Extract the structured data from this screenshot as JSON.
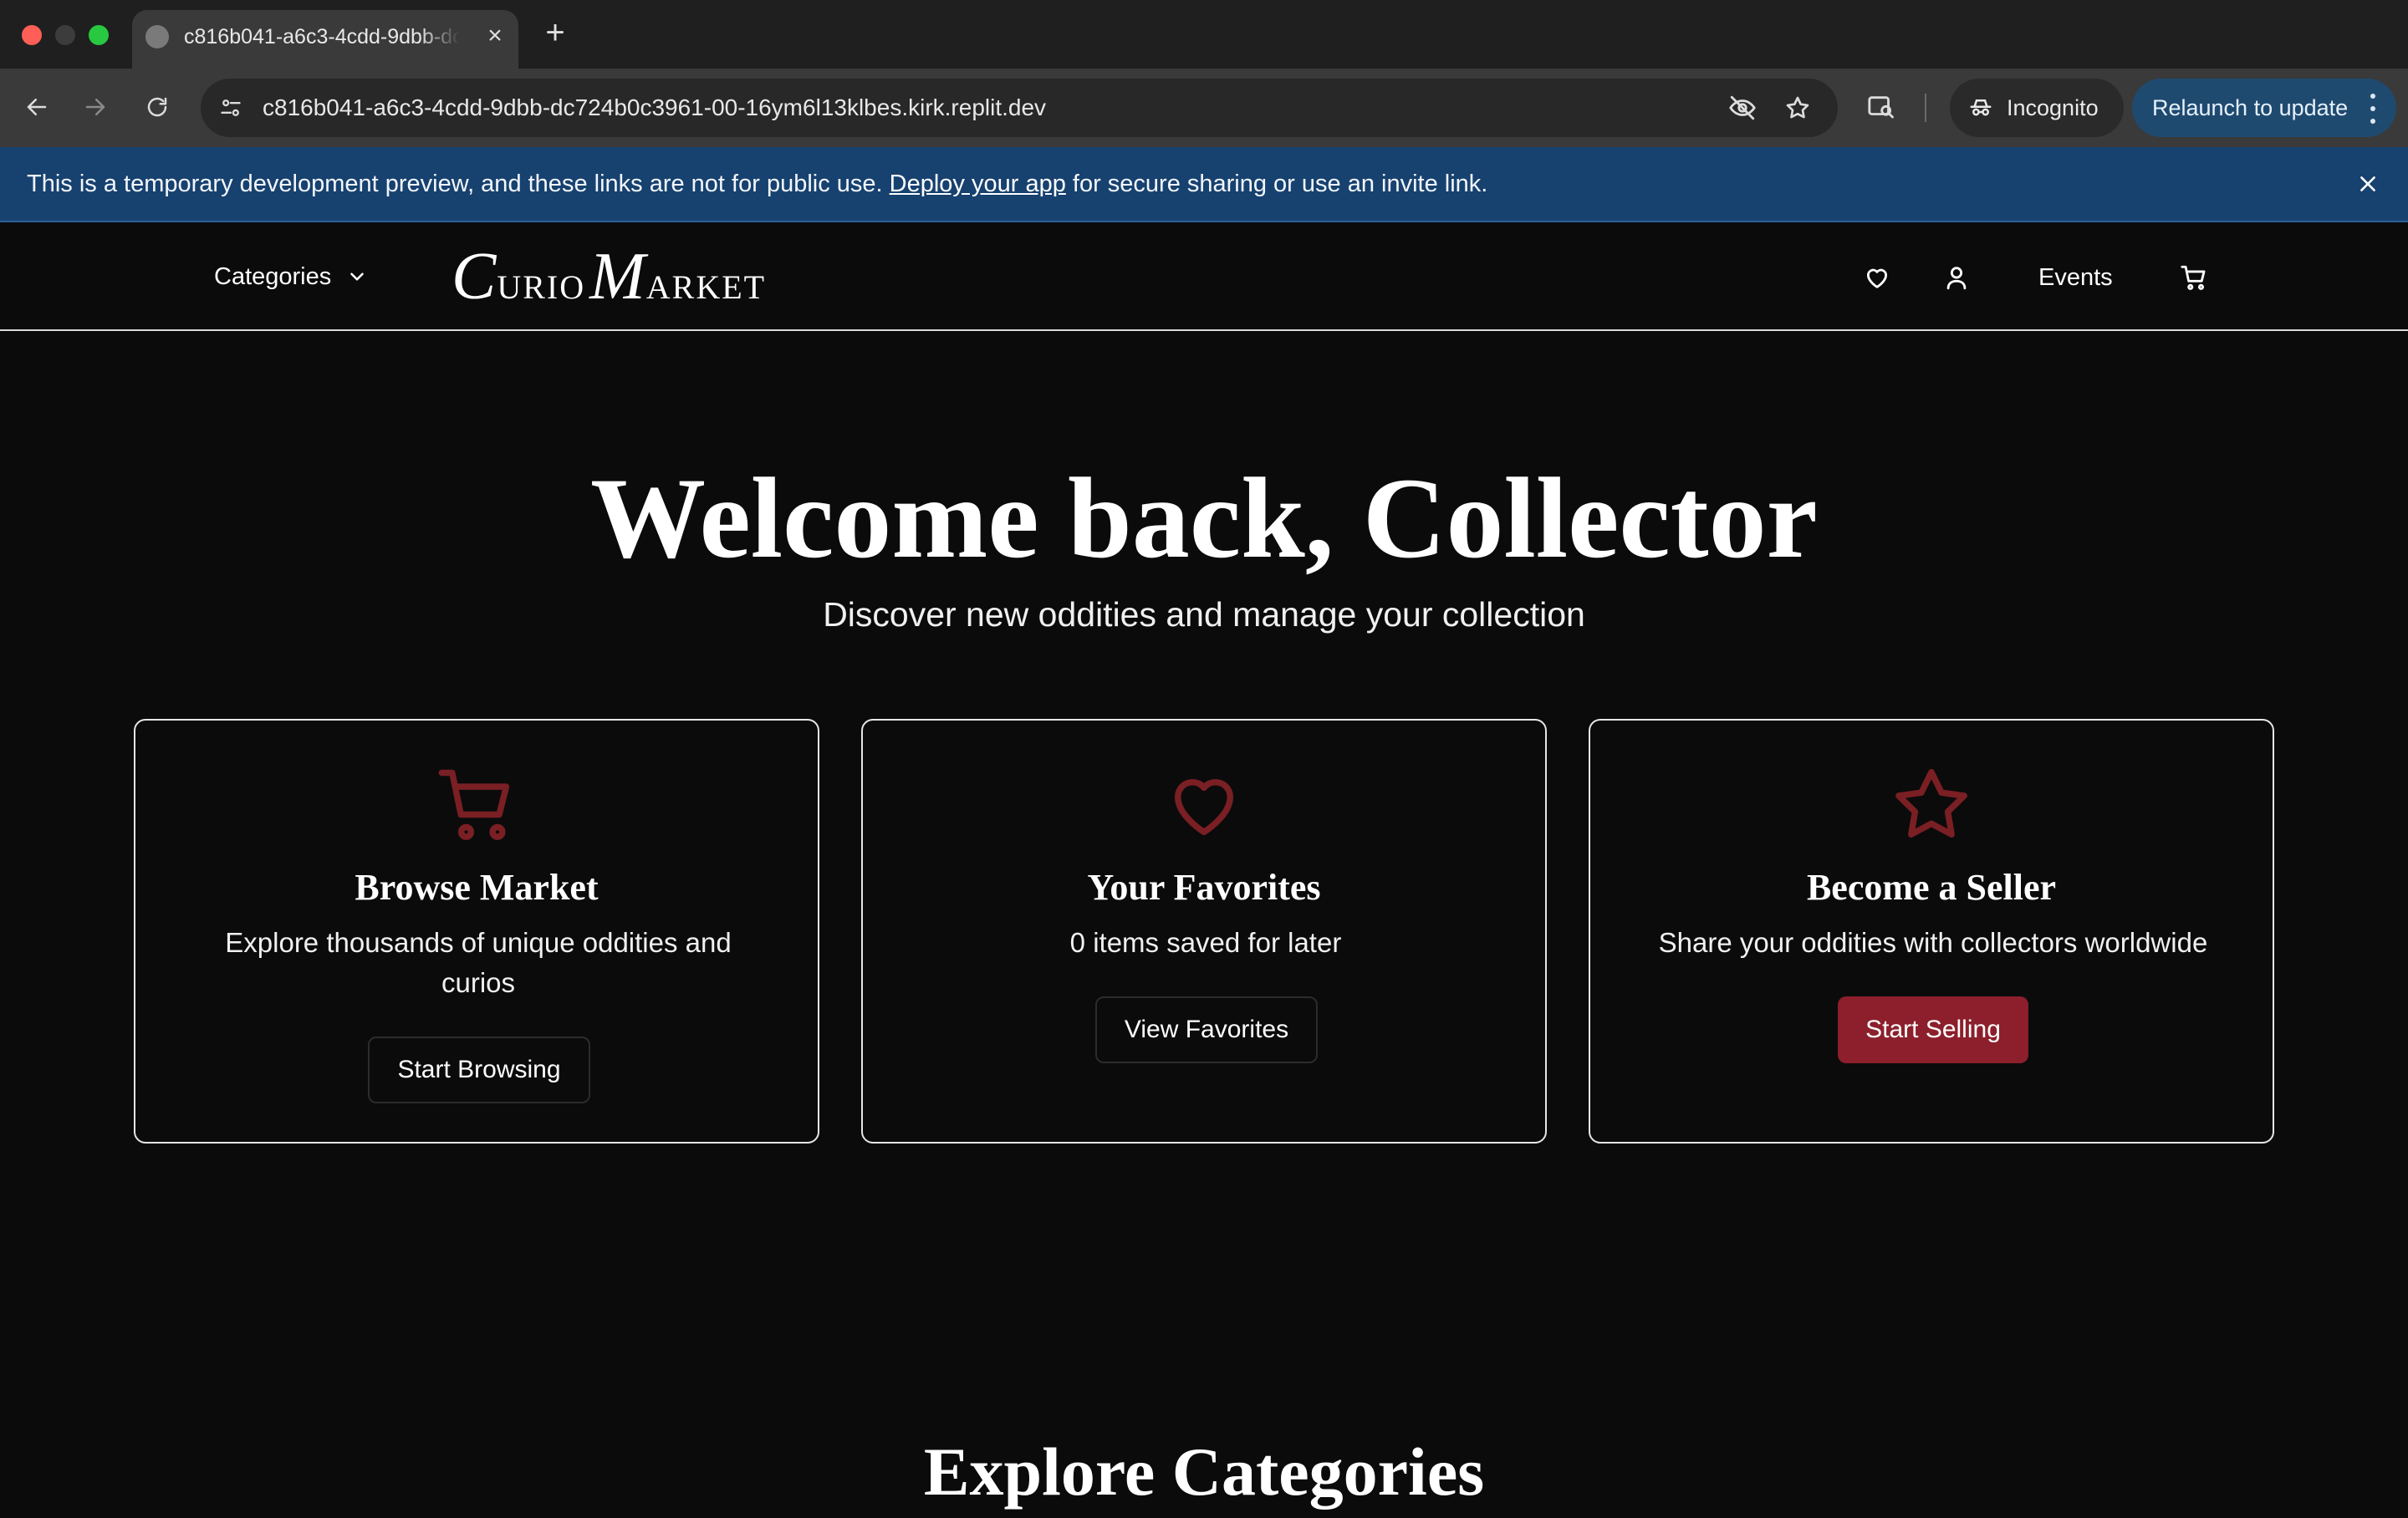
{
  "browser": {
    "tab_title": "c816b041-a6c3-4cdd-9dbb-dc724b0c3961-00-16ym6l13klbes.kirk.replit.dev",
    "url": "c816b041-a6c3-4cdd-9dbb-dc724b0c3961-00-16ym6l13klbes.kirk.replit.dev",
    "incognito_label": "Incognito",
    "relaunch_label": "Relaunch to update",
    "colors": {
      "tabbar": "#1f1f1f",
      "toolbar": "#3a3a3a",
      "relaunch": "#1f4a70"
    }
  },
  "banner": {
    "text_before": "This is a temporary development preview, and these links are not for public use. ",
    "link_text": "Deploy your app",
    "text_after": " for secure sharing or use an invite link.",
    "color": "#17416f"
  },
  "header": {
    "categories_label": "Categories",
    "logo": {
      "c": "C",
      "urio": "URIO",
      "m": "M",
      "arket": "ARKET"
    },
    "events_label": "Events",
    "icons": [
      "heart-icon",
      "user-icon",
      "cart-icon"
    ]
  },
  "hero": {
    "title": "Welcome back, Collector",
    "subtitle": "Discover new oddities and manage your collection"
  },
  "cards": [
    {
      "icon": "cart-icon",
      "title": "Browse Market",
      "description": "Explore thousands of unique oddities and curios",
      "button": "Start Browsing"
    },
    {
      "icon": "heart-icon",
      "title": "Your Favorites",
      "description": "0 items saved for later",
      "button": "View Favorites"
    },
    {
      "icon": "star-icon",
      "title": "Become a Seller",
      "description": "Share your oddities with collectors worldwide",
      "button": "Start Selling"
    }
  ],
  "explore": {
    "title": "Explore Categories"
  },
  "colors": {
    "accent": "#8c1f2b",
    "icon_accent": "#7a1f24",
    "background": "#0b0b0b"
  }
}
